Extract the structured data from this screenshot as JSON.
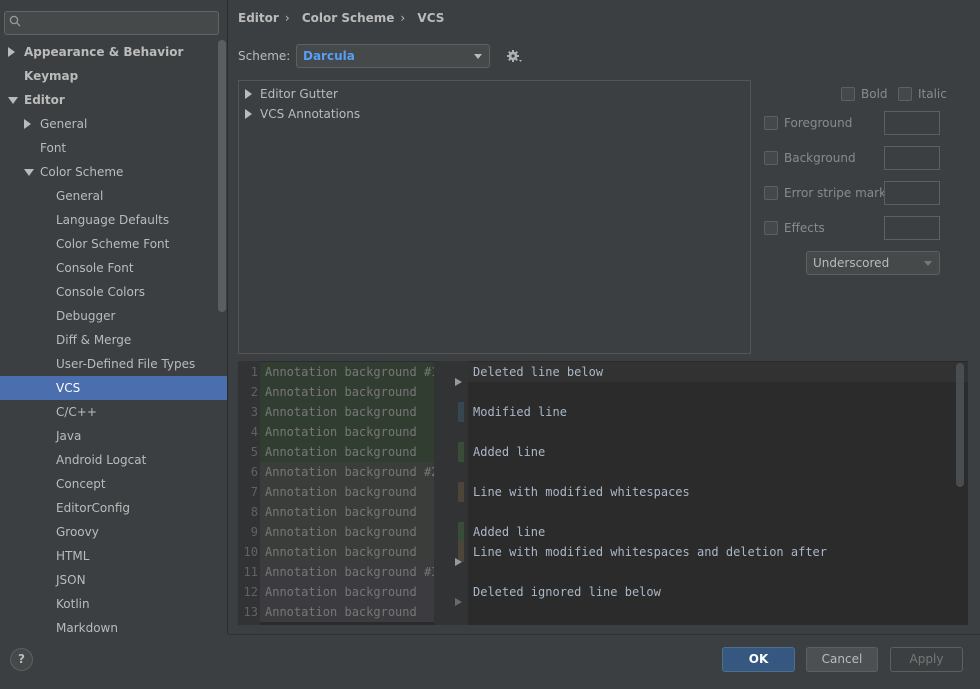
{
  "sidebar": {
    "search": {
      "placeholder": ""
    },
    "items": [
      {
        "label": "Appearance & Behavior",
        "indent": 0,
        "arrow": "right",
        "bold": true
      },
      {
        "label": "Keymap",
        "indent": 0,
        "arrow": "",
        "bold": true
      },
      {
        "label": "Editor",
        "indent": 0,
        "arrow": "down",
        "bold": true
      },
      {
        "label": "General",
        "indent": 1,
        "arrow": "right"
      },
      {
        "label": "Font",
        "indent": 1,
        "arrow": ""
      },
      {
        "label": "Color Scheme",
        "indent": 1,
        "arrow": "down"
      },
      {
        "label": "General",
        "indent": 2,
        "arrow": ""
      },
      {
        "label": "Language Defaults",
        "indent": 2,
        "arrow": ""
      },
      {
        "label": "Color Scheme Font",
        "indent": 2,
        "arrow": ""
      },
      {
        "label": "Console Font",
        "indent": 2,
        "arrow": ""
      },
      {
        "label": "Console Colors",
        "indent": 2,
        "arrow": ""
      },
      {
        "label": "Debugger",
        "indent": 2,
        "arrow": ""
      },
      {
        "label": "Diff & Merge",
        "indent": 2,
        "arrow": ""
      },
      {
        "label": "User-Defined File Types",
        "indent": 2,
        "arrow": ""
      },
      {
        "label": "VCS",
        "indent": 2,
        "arrow": "",
        "selected": true
      },
      {
        "label": "C/C++",
        "indent": 2,
        "arrow": ""
      },
      {
        "label": "Java",
        "indent": 2,
        "arrow": ""
      },
      {
        "label": "Android Logcat",
        "indent": 2,
        "arrow": ""
      },
      {
        "label": "Concept",
        "indent": 2,
        "arrow": ""
      },
      {
        "label": "EditorConfig",
        "indent": 2,
        "arrow": ""
      },
      {
        "label": "Groovy",
        "indent": 2,
        "arrow": ""
      },
      {
        "label": "HTML",
        "indent": 2,
        "arrow": ""
      },
      {
        "label": "JSON",
        "indent": 2,
        "arrow": ""
      },
      {
        "label": "Kotlin",
        "indent": 2,
        "arrow": ""
      },
      {
        "label": "Markdown",
        "indent": 2,
        "arrow": ""
      }
    ]
  },
  "breadcrumb": [
    "Editor",
    "Color Scheme",
    "VCS"
  ],
  "scheme": {
    "label": "Scheme:",
    "value": "Darcula"
  },
  "attributes": [
    "Editor Gutter",
    "VCS Annotations"
  ],
  "options": {
    "bold": "Bold",
    "italic": "Italic",
    "foreground": "Foreground",
    "background": "Background",
    "error_stripe": "Error stripe mark",
    "effects": "Effects",
    "effect_type": "Underscored"
  },
  "preview": {
    "annotations": [
      "Annotation background #1",
      "Annotation background",
      "Annotation background",
      "Annotation background",
      "Annotation background",
      "Annotation background #2",
      "Annotation background",
      "Annotation background",
      "Annotation background",
      "Annotation background",
      "Annotation background #3",
      "Annotation background",
      "Annotation background"
    ],
    "line_numbers": [
      "1",
      "2",
      "3",
      "4",
      "5",
      "6",
      "7",
      "8",
      "9",
      "10",
      "11",
      "12",
      "13"
    ],
    "code_lines": [
      {
        "row": 0,
        "text": "Deleted line below"
      },
      {
        "row": 2,
        "text": "Modified line"
      },
      {
        "row": 4,
        "text": "Added line"
      },
      {
        "row": 6,
        "text": "Line with modified whitespaces"
      },
      {
        "row": 8,
        "text": "Added line"
      },
      {
        "row": 9,
        "text": "Line with modified whitespaces and deletion after"
      },
      {
        "row": 11,
        "text": "Deleted ignored line below"
      }
    ],
    "annotation_colors": [
      "#323d32",
      "#3a3d3a",
      "#3b3b40"
    ],
    "vcs_colors": {
      "modified": "#374752",
      "added": "#384c38",
      "whitespace": "#4c4638"
    }
  },
  "buttons": {
    "help": "?",
    "ok": "OK",
    "cancel": "Cancel",
    "apply": "Apply"
  }
}
